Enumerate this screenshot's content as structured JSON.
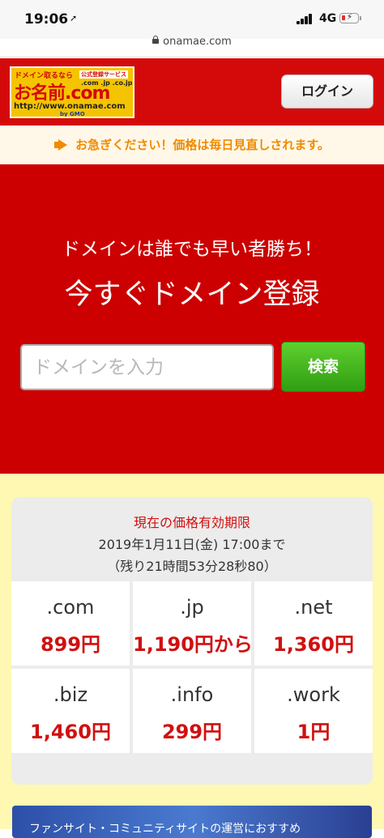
{
  "status_bar": {
    "time": "19:06",
    "network": "4G"
  },
  "browser": {
    "url": "onamae.com"
  },
  "header": {
    "logo": {
      "tagline": "ドメイン取るなら",
      "sub": "公式登録サービス",
      "tlds": ".com .jp .co.jp",
      "name": "お名前.com",
      "url": "http://www.onamae.com",
      "group": "by GMO"
    },
    "login_label": "ログイン"
  },
  "notice": {
    "text": "お急ぎください！価格は毎日見直しされます。"
  },
  "hero": {
    "subtitle": "ドメインは誰でも早い者勝ち！",
    "title": "今すぐドメイン登録",
    "search_placeholder": "ドメインを入力",
    "search_button": "検索"
  },
  "pricing": {
    "period_label": "現在の価格有効期限",
    "period_date": "2019年1月11日(金) 17:00まで",
    "period_remaining": "（残り21時間53分28秒80）",
    "items": [
      {
        "tld": ".com",
        "price": "899円"
      },
      {
        "tld": ".jp",
        "price": "1,190円から"
      },
      {
        "tld": ".net",
        "price": "1,360円"
      },
      {
        "tld": ".biz",
        "price": "1,460円"
      },
      {
        "tld": ".info",
        "price": "299円"
      },
      {
        "tld": ".work",
        "price": "1円"
      }
    ]
  },
  "banner": {
    "text": "ファンサイト・コミュニティサイトの運営におすすめ"
  },
  "colors": {
    "brand_red": "#cc0000",
    "notice_orange": "#f08a00",
    "search_green": "#3aae1c",
    "price_red": "#d01010",
    "panel_yellow": "#fff8b3"
  }
}
